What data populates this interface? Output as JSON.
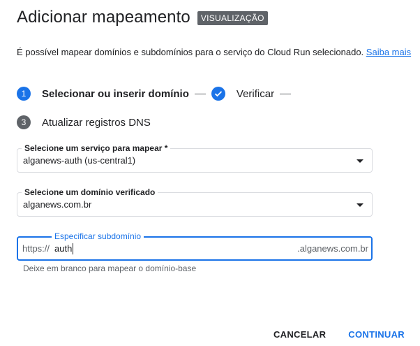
{
  "dialog": {
    "title": "Adicionar mapeamento",
    "badge": "VISUALIZAÇÃO",
    "description": "É possível mapear domínios e subdomínios para o serviço do Cloud Run selecionado.",
    "learn_more": "Saiba mais"
  },
  "stepper": {
    "steps": [
      {
        "number": "1",
        "label": "Selecionar ou inserir domínio",
        "state": "active"
      },
      {
        "number": "",
        "label": "Verificar",
        "state": "done"
      },
      {
        "number": "3",
        "label": "Atualizar registros DNS",
        "state": "pending"
      }
    ]
  },
  "form": {
    "service": {
      "label": "Selecione um serviço para mapear *",
      "value": "alganews-auth (us-central1)"
    },
    "domain": {
      "label": "Selecione um domínio verificado",
      "value": "alganews.com.br"
    },
    "subdomain": {
      "label": "Especificar subdomínio",
      "prefix": "https://",
      "value": "auth",
      "suffix": ".alganews.com.br",
      "hint": "Deixe em branco para mapear o domínio-base"
    }
  },
  "actions": {
    "cancel": "CANCELAR",
    "continue": "CONTINUAR"
  },
  "colors": {
    "accent": "#1a73e8",
    "badge_bg": "#5f6368"
  }
}
